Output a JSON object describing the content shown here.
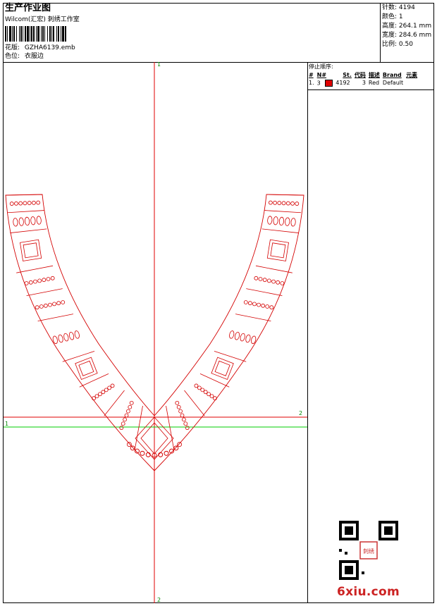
{
  "header": {
    "title": "生产作业图",
    "software": "Wilcom(汇宏) 刺绣工作室",
    "design_file_label": "花版:",
    "design_file": "GZHA6139.emb",
    "color_label": "色位:",
    "color_value": "衣服边"
  },
  "specs": [
    {
      "label": "针数:",
      "value": "4194"
    },
    {
      "label": "颜色:",
      "value": "1"
    },
    {
      "label": "高度:",
      "value": "264.1 mm"
    },
    {
      "label": "宽度:",
      "value": "284.6 mm"
    },
    {
      "label": "比例:",
      "value": "0.50"
    }
  ],
  "stop_sequence": {
    "title": "停止顺序:",
    "columns": [
      "#",
      "N#",
      "St.",
      "代码",
      "描述",
      "Brand",
      "元素"
    ],
    "rows": [
      {
        "index": "1.",
        "needle": "3",
        "stitches": "4192",
        "code": "3",
        "description": "Red",
        "brand": "Default",
        "swatch_color": "#e00000"
      }
    ]
  },
  "axis_labels": {
    "top": "1",
    "bottom": "2",
    "left": "1",
    "right": "2"
  },
  "colors": {
    "design": "#d40000",
    "axis": "#e00000",
    "guide": "#00cc00"
  },
  "watermark": {
    "text": "6xiu.com",
    "stamp": "刺绣"
  }
}
